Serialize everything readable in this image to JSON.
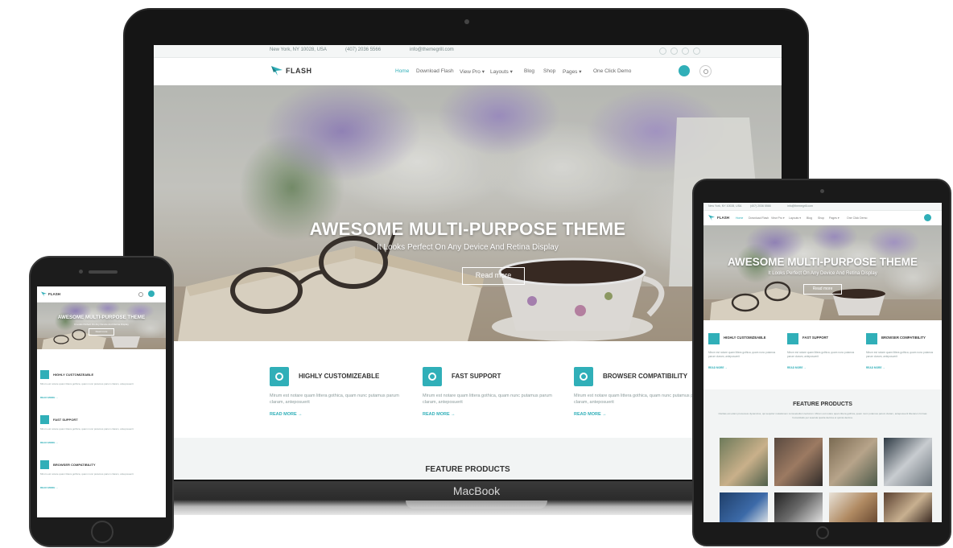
{
  "mac": {
    "brand": "MacBook",
    "site": {
      "topbar": {
        "location": "New York, NY 10028, USA",
        "phone": "(407) 2036 5566",
        "email": "info@themegrill.com"
      },
      "logo_text": "FLASH",
      "menu": [
        "Home",
        "Download Flash",
        "View Pro ▾",
        "Layouts ▾",
        "Blog",
        "Shop",
        "Pages ▾",
        "One Click Demo"
      ],
      "hero": {
        "title": "AWESOME MULTI-PURPOSE THEME",
        "subtitle": "It Looks Perfect On Any Device And Retina Display",
        "button": "Read more"
      },
      "features": [
        {
          "title": "HIGHLY CUSTOMIZEABLE",
          "text": "Mirum est notare quam littera gothica, quam nunc putamus parum claram, anteposuerit",
          "more": "READ MORE →"
        },
        {
          "title": "FAST SUPPORT",
          "text": "Mirum est notare quam littera gothica, quam nunc putamus parum claram, anteposuerit",
          "more": "READ MORE →"
        },
        {
          "title": "BROWSER COMPATIBILITY",
          "text": "Mirum est notare quam littera gothica, quam nunc putamus parum claram, anteposuerit",
          "more": "READ MORE →"
        }
      ],
      "products_title": "FEATURE PRODUCTS"
    }
  },
  "tablet": {
    "topbar": {
      "location": "New York, NY 10028, USA",
      "phone": "(407) 2036 5566",
      "email": "info@themegrill.com"
    },
    "logo_text": "FLASH",
    "menu": [
      "Home",
      "Download Flash",
      "View Pro ▾",
      "Layouts ▾",
      "Blog",
      "Shop",
      "Pages ▾",
      "One Click Demo"
    ],
    "hero": {
      "title": "AWESOME MULTI-PURPOSE THEME",
      "subtitle": "It Looks Perfect On Any Device And Retina Display",
      "button": "Read more"
    },
    "features": [
      {
        "title": "HIGHLY CUSTOMIZEABLE",
        "text": "Mirum est notare quam littera gothica, quam nunc putamus parum claram, anteposuerit",
        "more": "READ MORE →"
      },
      {
        "title": "FAST SUPPORT",
        "text": "Mirum est notare quam littera gothica, quam nunc putamus parum claram, anteposuerit",
        "more": "READ MORE →"
      },
      {
        "title": "BROWSER COMPATIBILITY",
        "text": "Mirum est notare quam littera gothica, quam nunc putamus parum claram, anteposuerit",
        "more": "READ MORE →"
      }
    ],
    "products_title": "FEATURE PRODUCTS",
    "products_text": "Claritas est etiam processus dynamicus, qui sequitur mutationem consuetudium lectorum. Mirum est notare quam littera gothica, quam nunc putamus parum claram, anteposuerit litterarum formas humanitatis per seacula quarta decima et quinta decima."
  },
  "phone": {
    "logo_text": "FLASH",
    "hero": {
      "title": "AWESOME MULTI-PURPOSE THEME",
      "subtitle": "It Looks Perfect On Any Device And Retina Display",
      "button": "Read more"
    },
    "features": [
      {
        "title": "HIGHLY CUSTOMIZEABLE",
        "text": "Mirum est notare quam littera gothica, quam nunc putamus parum claram, anteposuerit",
        "more": "READ MORE →"
      },
      {
        "title": "FAST SUPPORT",
        "text": "Mirum est notare quam littera gothica, quam nunc putamus parum claram, anteposuerit",
        "more": "READ MORE →"
      },
      {
        "title": "BROWSER COMPATIBILITY",
        "text": "Mirum est notare quam littera gothica, quam nunc putamus parum claram, anteposuerit",
        "more": "READ MORE →"
      }
    ]
  },
  "colors": {
    "accent": "#30afb8",
    "device": "#151515"
  },
  "icons": [
    "logo-icon",
    "location-icon",
    "phone-icon",
    "email-icon",
    "social-icon",
    "cart-icon",
    "search-icon",
    "gear-icon",
    "support-icon",
    "compass-icon",
    "menu-icon",
    "camera-icon",
    "home-button-icon"
  ]
}
